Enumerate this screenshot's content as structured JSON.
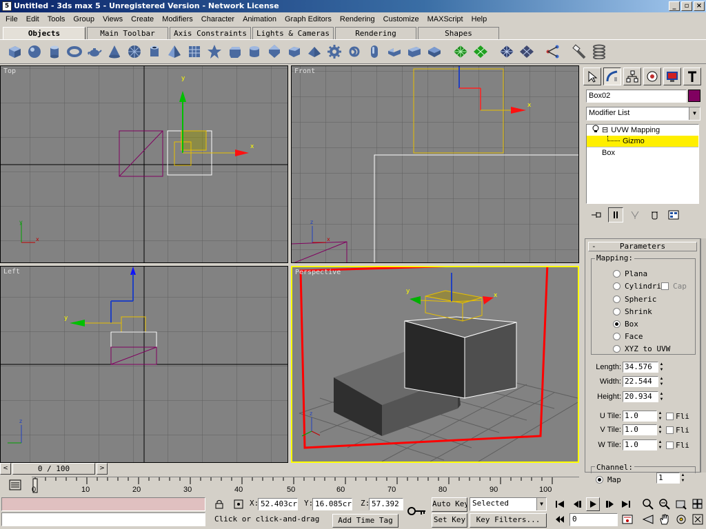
{
  "window": {
    "title": "Untitled - 3ds max 5 - Unregistered Version - Network License",
    "icon_label": "5"
  },
  "menu": [
    "File",
    "Edit",
    "Tools",
    "Group",
    "Views",
    "Create",
    "Modifiers",
    "Character",
    "Animation",
    "Graph Editors",
    "Rendering",
    "Customize",
    "MAXScript",
    "Help"
  ],
  "tabs": [
    "Objects",
    "Main Toolbar",
    "Axis Constraints",
    "Lights & Cameras",
    "Rendering",
    "Shapes"
  ],
  "toolbar_icons": [
    "box-icon",
    "sphere-icon",
    "cylinder-icon",
    "torus-icon",
    "teapot-icon",
    "cone-icon",
    "geosphere-icon",
    "tube-icon",
    "pyramid-icon",
    "plane-icon",
    "hedra-icon",
    "chamferbox-icon",
    "oiltank-icon",
    "spindle-icon",
    "gengon-icon",
    "prism-icon",
    "gear-icon",
    "torusknot-icon",
    "capsule-icon",
    "l-ext-icon",
    "c-ext-icon",
    "ringwave-icon",
    "patch-quad-icon",
    "patch-tri-icon",
    "nurbs-surface-icon",
    "nurbs-cv-icon",
    "bone-icon",
    "paint-icon",
    "spring-icon"
  ],
  "viewports": {
    "top": {
      "label": "Top"
    },
    "front": {
      "label": "Front"
    },
    "left": {
      "label": "Left"
    },
    "perspective": {
      "label": "Perspective"
    }
  },
  "axes": {
    "x": "x",
    "y": "y",
    "z": "z"
  },
  "command_panel": {
    "object_name": "Box02",
    "object_color": "#800060",
    "modifier_list": "Modifier List",
    "stack": [
      {
        "label": "UVW Mapping",
        "expander": "⊟"
      },
      {
        "label": "Gizmo"
      },
      {
        "label": "Box"
      }
    ],
    "rollout_toggle": "-",
    "rollout_title": "Parameters",
    "mapping": {
      "label": "Mapping:",
      "options": [
        "Plana",
        "Cylindri",
        "Spheric",
        "Shrink",
        "Box",
        "Face",
        "XYZ to UVW"
      ],
      "selected": "Box",
      "cap_label": "Cap"
    },
    "dimensions": [
      {
        "label": "Length:",
        "value": "34.576"
      },
      {
        "label": "Width:",
        "value": "22.544"
      },
      {
        "label": "Height:",
        "value": "20.934"
      }
    ],
    "tiles": [
      {
        "label": "U Tile:",
        "value": "1.0",
        "flip": "Fli"
      },
      {
        "label": "V Tile:",
        "value": "1.0",
        "flip": "Fli"
      },
      {
        "label": "W Tile:",
        "value": "1.0",
        "flip": "Fli"
      }
    ],
    "channel": {
      "label": "Channel:",
      "option": "Map",
      "value": "1"
    }
  },
  "time": {
    "frame_display": "0 / 100",
    "ticks": [
      "0",
      "10",
      "20",
      "30",
      "40",
      "50",
      "60",
      "70",
      "80",
      "90",
      "100"
    ]
  },
  "status": {
    "x_label": "X:",
    "x_value": "52.403cr",
    "y_label": "Y:",
    "y_value": "16.085cr",
    "z_label": "Z:",
    "z_value": "57.392",
    "prompt": "Click or click-and-drag",
    "add_time_tag": "Add Time Tag",
    "auto_key": "Auto Key",
    "set_key": "Set Key",
    "selected": "Selected",
    "key_filters": "Key Filters...",
    "frame_field": "0"
  }
}
